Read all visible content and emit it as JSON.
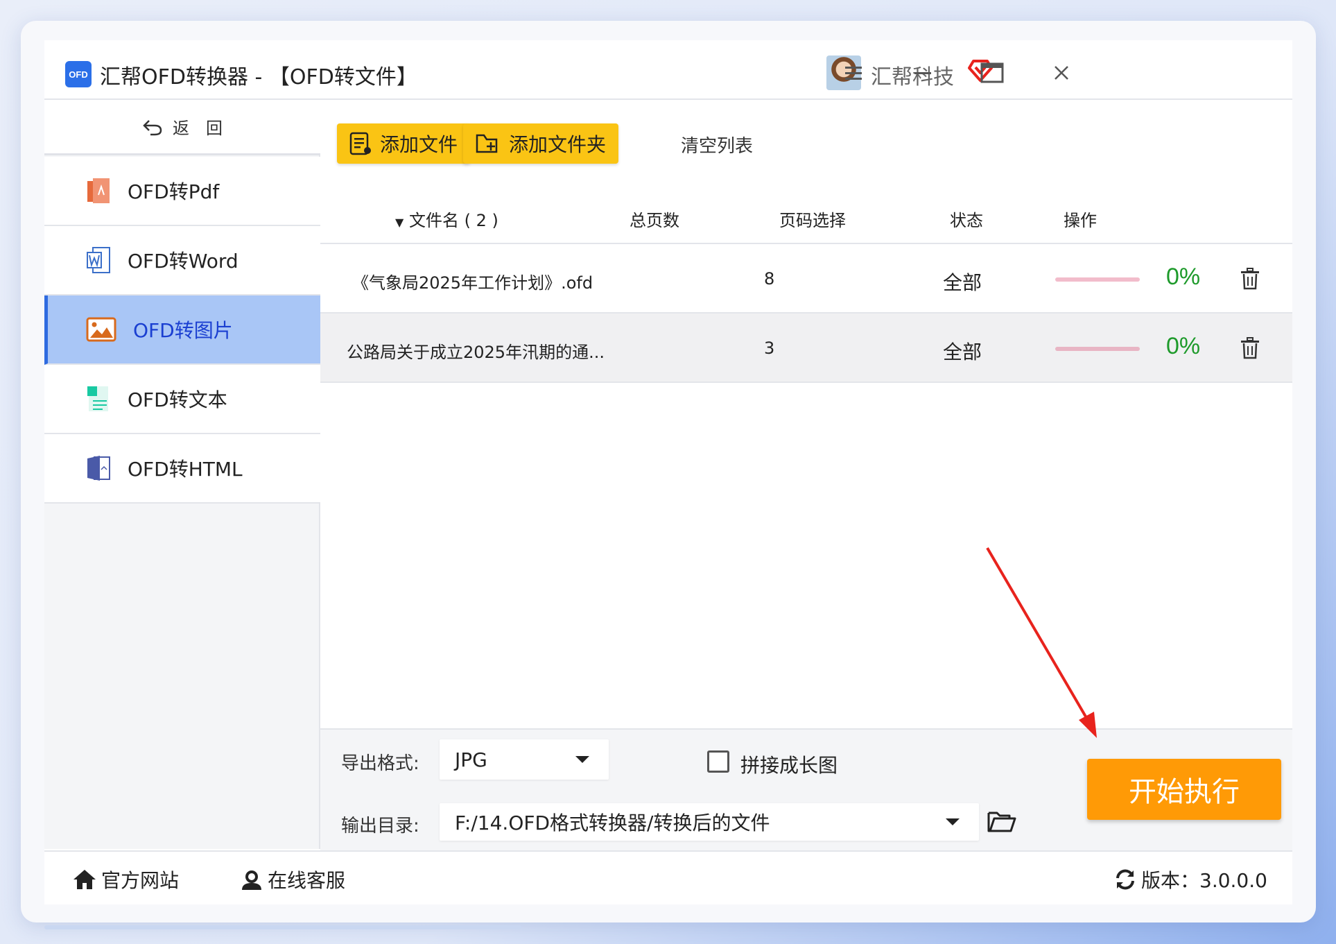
{
  "window": {
    "logo_text": "OFD",
    "title": "汇帮OFD转换器 - 【OFD转文件】",
    "brand": "汇帮科技"
  },
  "sidebar": {
    "back_label": "返　回",
    "items": [
      {
        "label": "OFD转Pdf",
        "icon": "pdf-icon"
      },
      {
        "label": "OFD转Word",
        "icon": "word-icon"
      },
      {
        "label": "OFD转图片",
        "icon": "image-icon",
        "active": true
      },
      {
        "label": "OFD转文本",
        "icon": "text-icon"
      },
      {
        "label": "OFD转HTML",
        "icon": "html-icon"
      }
    ]
  },
  "toolbar": {
    "add_file": "添加文件",
    "add_folder": "添加文件夹",
    "clear_list": "清空列表"
  },
  "table": {
    "headers": {
      "filename": "文件名 ( 2 )",
      "pages": "总页数",
      "page_select": "页码选择",
      "status": "状态",
      "action": "操作"
    },
    "rows": [
      {
        "filename": "《气象局2025年工作计划》.ofd",
        "pages": "8",
        "page_select": "全部",
        "progress": 0,
        "percent": "0%"
      },
      {
        "filename": "公路局关于成立2025年汛期的通...",
        "pages": "3",
        "page_select": "全部",
        "progress": 0,
        "percent": "0%"
      }
    ]
  },
  "bottom": {
    "format_label": "导出格式:",
    "format_value": "JPG",
    "merge_label": "拼接成长图",
    "merge_checked": false,
    "output_label": "输出目录:",
    "output_value": "F:/14.OFD格式转换器/转换后的文件",
    "start_label": "开始执行"
  },
  "footer": {
    "website": "官方网站",
    "support": "在线客服",
    "version": "版本：3.0.0.0"
  },
  "colors": {
    "accent_yellow": "#fac414",
    "start_orange": "#ff9a06",
    "active_nav": "#a9c6f6",
    "active_text": "#1a3fd1",
    "percent_green": "#1e9a2b",
    "arrow_red": "#e8231d"
  }
}
